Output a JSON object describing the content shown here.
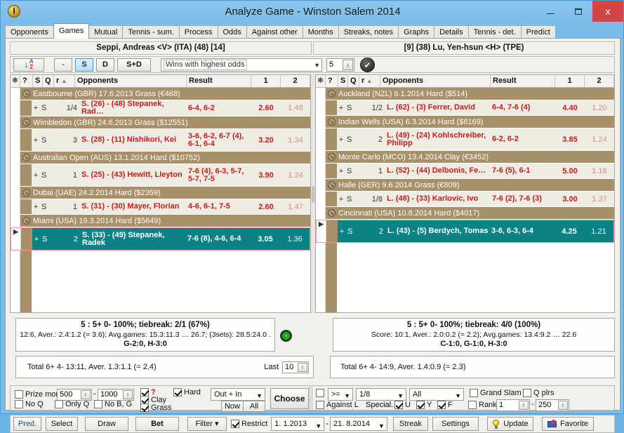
{
  "window": {
    "title": "Analyze Game - Winston Salem 2014",
    "minimize": "–",
    "maximize": "❐",
    "close": "x",
    "app_icon": "medal-icon"
  },
  "tabs": [
    {
      "label": "Opponents",
      "active": false
    },
    {
      "label": "Games",
      "active": true
    },
    {
      "label": "Mutual",
      "active": false
    },
    {
      "label": "Tennis - sum.",
      "active": false
    },
    {
      "label": "Process",
      "active": false
    },
    {
      "label": "Odds",
      "active": false
    },
    {
      "label": "Against other",
      "active": false
    },
    {
      "label": "Months",
      "active": false
    },
    {
      "label": "Streaks, notes",
      "active": false
    },
    {
      "label": "Graphs",
      "active": false
    },
    {
      "label": "Details",
      "active": false
    },
    {
      "label": "Tennis - det.",
      "active": false
    },
    {
      "label": "Predict",
      "active": false
    }
  ],
  "players": {
    "left": "Seppi, Andreas <V> (ITA) (48) [14]",
    "right": "[9] (38) Lu, Yen-hsun <H> (TPE)"
  },
  "toolbar": {
    "sort_button": "A-Z",
    "sort_letter_top": "A",
    "sort_letter_bottom": "Z",
    "dash": "-",
    "single": "S",
    "double": "D",
    "single_double": "S+D",
    "filter_select": "Wins with highest odds",
    "count_value": "5",
    "ok_glyph": "✔"
  },
  "columns": {
    "asterisk": "✱",
    "question": "?",
    "s": "S",
    "q": "Q",
    "r": "r",
    "sort_arrow": "▲",
    "opponents": "Opponents",
    "result": "Result",
    "odds1": "1",
    "odds2": "2"
  },
  "left_grid": [
    {
      "type": "tournament",
      "text": "Eastbourne (GBR) 17.6.2013  Grass  (€468)"
    },
    {
      "type": "match",
      "plus": "+",
      "s": "S",
      "q": "",
      "round": "1/4",
      "opponent": "S. (26) - (48) Stepanek, Rad…",
      "result": "6-4, 6-2",
      "odds1": "2.60",
      "odds2": "1.48",
      "selected": false,
      "tall": false
    },
    {
      "type": "tournament",
      "text": "Wimbledon (GBR) 24.6.2013  Grass  ($12551)"
    },
    {
      "type": "match",
      "plus": "+",
      "s": "S",
      "q": "",
      "round": "3",
      "opponent": "S. (28) - (11) Nishikori, Kei",
      "result": "3-6, 6-2, 6-7 (4), 6-1, 6-4",
      "odds1": "3.20",
      "odds2": "1.34",
      "selected": false,
      "tall": true
    },
    {
      "type": "tournament",
      "text": "Australian Open (AUS) 13.1.2014  Hard  ($10752)"
    },
    {
      "type": "match",
      "plus": "+",
      "s": "S",
      "q": "",
      "round": "1",
      "opponent": "S. (25) - (43) Hewitt, Lleyton",
      "result": "7-6 (4), 6-3, 5-7, 5-7, 7-5",
      "odds1": "3.90",
      "odds2": "1.24",
      "selected": false,
      "tall": true
    },
    {
      "type": "tournament",
      "text": "Dubai (UAE) 24.2.2014  Hard  ($2359)"
    },
    {
      "type": "match",
      "plus": "+",
      "s": "S",
      "q": "",
      "round": "1",
      "opponent": "S. (31) - (30) Mayer, Florian",
      "result": "4-6, 6-1, 7-5",
      "odds1": "2.60",
      "odds2": "1.47",
      "selected": false,
      "tall": false
    },
    {
      "type": "tournament",
      "text": "Miami (USA) 19.3.2014  Hard  ($5649)"
    },
    {
      "type": "match",
      "plus": "+",
      "s": "S",
      "q": "",
      "round": "2",
      "opponent": "S. (33) - (49) Stepanek, Radek",
      "result": "7-6 (8), 4-6, 6-4",
      "odds1": "3.05",
      "odds2": "1.36",
      "selected": true,
      "tall": true
    }
  ],
  "right_grid": [
    {
      "type": "tournament",
      "text": "Auckland (NZL) 6.1.2014  Hard  ($514)"
    },
    {
      "type": "match",
      "plus": "+",
      "s": "S",
      "q": "",
      "round": "1/2",
      "opponent": "L. (62) - (3) Ferrer, David",
      "result": "6-4, 7-6 (4)",
      "odds1": "4.40",
      "odds2": "1.20",
      "selected": false,
      "tall": false
    },
    {
      "type": "tournament",
      "text": "Indian Wells (USA) 6.3.2014  Hard  ($6169)"
    },
    {
      "type": "match",
      "plus": "+",
      "s": "S",
      "q": "",
      "round": "2",
      "opponent": "L. (49) - (24) Kohlschreiber, Philipp",
      "result": "6-2, 6-2",
      "odds1": "3.85",
      "odds2": "1.24",
      "selected": false,
      "tall": true
    },
    {
      "type": "tournament",
      "text": "Monte Carlo (MCO) 13.4.2014  Clay  (€3452)"
    },
    {
      "type": "match",
      "plus": "+",
      "s": "S",
      "q": "",
      "round": "1",
      "opponent": "L. (52) - (44) Delbonis, Fe…",
      "result": "7-6 (5), 6-1",
      "odds1": "5.00",
      "odds2": "1.16",
      "selected": false,
      "tall": false
    },
    {
      "type": "tournament",
      "text": "Halle (GER) 9.6.2014  Grass  (€809)"
    },
    {
      "type": "match",
      "plus": "+",
      "s": "S",
      "q": "",
      "round": "1/8",
      "opponent": "L. (48) - (33) Karlovic, Ivo",
      "result": "7-6 (2), 7-6 (3)",
      "odds1": "3.00",
      "odds2": "1.37",
      "selected": false,
      "tall": false
    },
    {
      "type": "tournament",
      "text": "Cincinnati (USA) 10.8.2014  Hard  ($4017)"
    },
    {
      "type": "match",
      "plus": "+",
      "s": "S",
      "q": "",
      "round": "2",
      "opponent": "L. (43) - (5) Berdych, Tomas",
      "result": "3-6, 6-3, 6-4",
      "odds1": "4.25",
      "odds2": "1.21",
      "selected": true,
      "tall": true
    }
  ],
  "stats": {
    "left": {
      "line1": "5 : 5+  0-  100%; tiebreak: 2/1 (67%)",
      "line2": "12:6, Aver.: 2.4:1.2 (= 3.6);  Avg.games: 15.3:11.3 … 26.7;  (3sets): 28.5:24.0 .",
      "line3": "G-2:0, H-3:0"
    },
    "right": {
      "line1": "5 : 5+  0-  100%; tiebreak: 4/0 (100%)",
      "line2": "Score: 10:1, Aver.: 2.0:0.2 (= 2.2);  Avg.games: 13.4:9.2 … 22.6",
      "line3": "C-1:0, G-1:0, H-3:0"
    }
  },
  "totals": {
    "left": "Total    6+  4-   13:11,  Aver. 1.3:1.1 (= 2.4)",
    "right": "Total   6+  4-   14:9,  Aver. 1.4:0.9 (= 2.3)",
    "last_label": "Last",
    "last_value": "10"
  },
  "filters": {
    "prize_money_label": "Prize mon",
    "prize_money_checked": false,
    "prize_from": "500",
    "prize_dash": "-",
    "prize_to": "1000",
    "no_q_label": "No Q",
    "no_q_checked": false,
    "only_q_label": "Only Q",
    "only_q_checked": false,
    "no_bg_label": "No B, G",
    "no_bg_checked": false,
    "question_label": "?",
    "question_checked": true,
    "clay_label": "Clay",
    "clay_checked": true,
    "grass_label": "Grass",
    "grass_checked": true,
    "hard_label": "Hard",
    "hard_checked": true,
    "outin_value": "Out + In",
    "now_label": "Now",
    "all_label": "All",
    "choose_label": "Choose",
    "cmp_checkbox": false,
    "cmp_value": ">=",
    "round_value": "1/8",
    "all_value": "All",
    "grand_slam_label": "Grand Slam",
    "grand_slam_checked": false,
    "q_plrs_label": "Q plrs",
    "q_plrs_checked": false,
    "against_l_label": "Against L",
    "against_l_checked": false,
    "special_label": "Special.",
    "u_label": "U",
    "u_checked": true,
    "y_label": "Y",
    "y_checked": true,
    "f_label": "F",
    "f_checked": true,
    "rank_label": "Rank.",
    "rank_checked": false,
    "rank_from": "1",
    "rank_dash": "-",
    "rank_to": "250"
  },
  "bottom": {
    "pred": "Pred.",
    "select": "Select",
    "draw": "Draw",
    "bet": "Bet",
    "filter": "Filter ▾",
    "restrict_label": "Restrict",
    "restrict_checked": true,
    "date_from": "1.  1.2013",
    "date_dash": "-",
    "date_to": "21.  8.2014",
    "streak": "Streak",
    "settings": "Settings",
    "update": "Update",
    "favorite": "Favorite"
  }
}
